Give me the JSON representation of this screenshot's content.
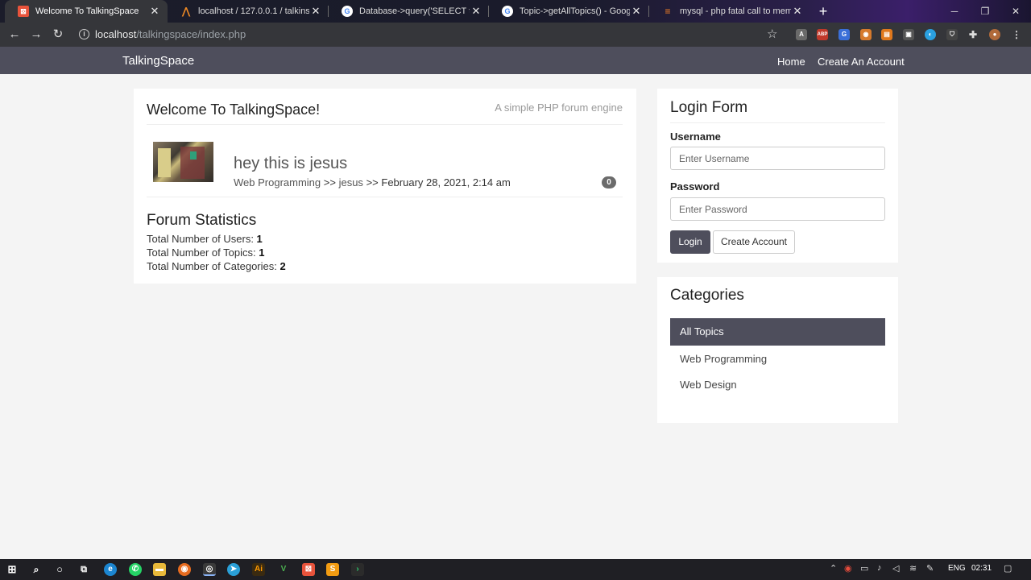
{
  "browser": {
    "tabs": [
      {
        "label": "Welcome To TalkingSpace",
        "icon": "xampp-icon",
        "color": "#e8533b",
        "active": true
      },
      {
        "label": "localhost / 127.0.0.1 / talkinspace",
        "icon": "phpmyadmin-icon",
        "color": "#f08a24",
        "active": false
      },
      {
        "label": "Database->query('SELECT topics",
        "icon": "google-icon",
        "color": "#4285f4",
        "active": false
      },
      {
        "label": "Topic->getAllTopics() - Google S",
        "icon": "google-icon",
        "color": "#4285f4",
        "active": false
      },
      {
        "label": "mysql - php fatal call to member",
        "icon": "stackoverflow-icon",
        "color": "#f48024",
        "active": false
      }
    ],
    "new_tab_label": "+",
    "url_host": "localhost",
    "url_path": "/talkingspace/index.php"
  },
  "site": {
    "brand": "TalkingSpace",
    "nav": {
      "home": "Home",
      "create_account": "Create An Account"
    }
  },
  "main": {
    "title": "Welcome To TalkingSpace!",
    "tagline": "A simple PHP forum engine",
    "topic": {
      "title": "hey this is jesus",
      "category": "Web Programming",
      "separator": ">>",
      "author": "jesus",
      "date": "February 28, 2021, 2:14 am",
      "replies": "0"
    },
    "stats": {
      "title": "Forum Statistics",
      "users_label": "Total Number of Users: ",
      "users": "1",
      "topics_label": "Total Number of Topics: ",
      "topics": "1",
      "categories_label": "Total Number of Categories: ",
      "categories": "2"
    }
  },
  "login": {
    "title": "Login Form",
    "username_label": "Username",
    "username_placeholder": "Enter Username",
    "password_label": "Password",
    "password_placeholder": "Enter Password",
    "login_button": "Login",
    "create_button": "Create Account"
  },
  "categories": {
    "title": "Categories",
    "items": [
      "All Topics",
      "Web Programming",
      "Web Design"
    ]
  },
  "taskbar": {
    "lang": "ENG",
    "time": "02:31"
  }
}
